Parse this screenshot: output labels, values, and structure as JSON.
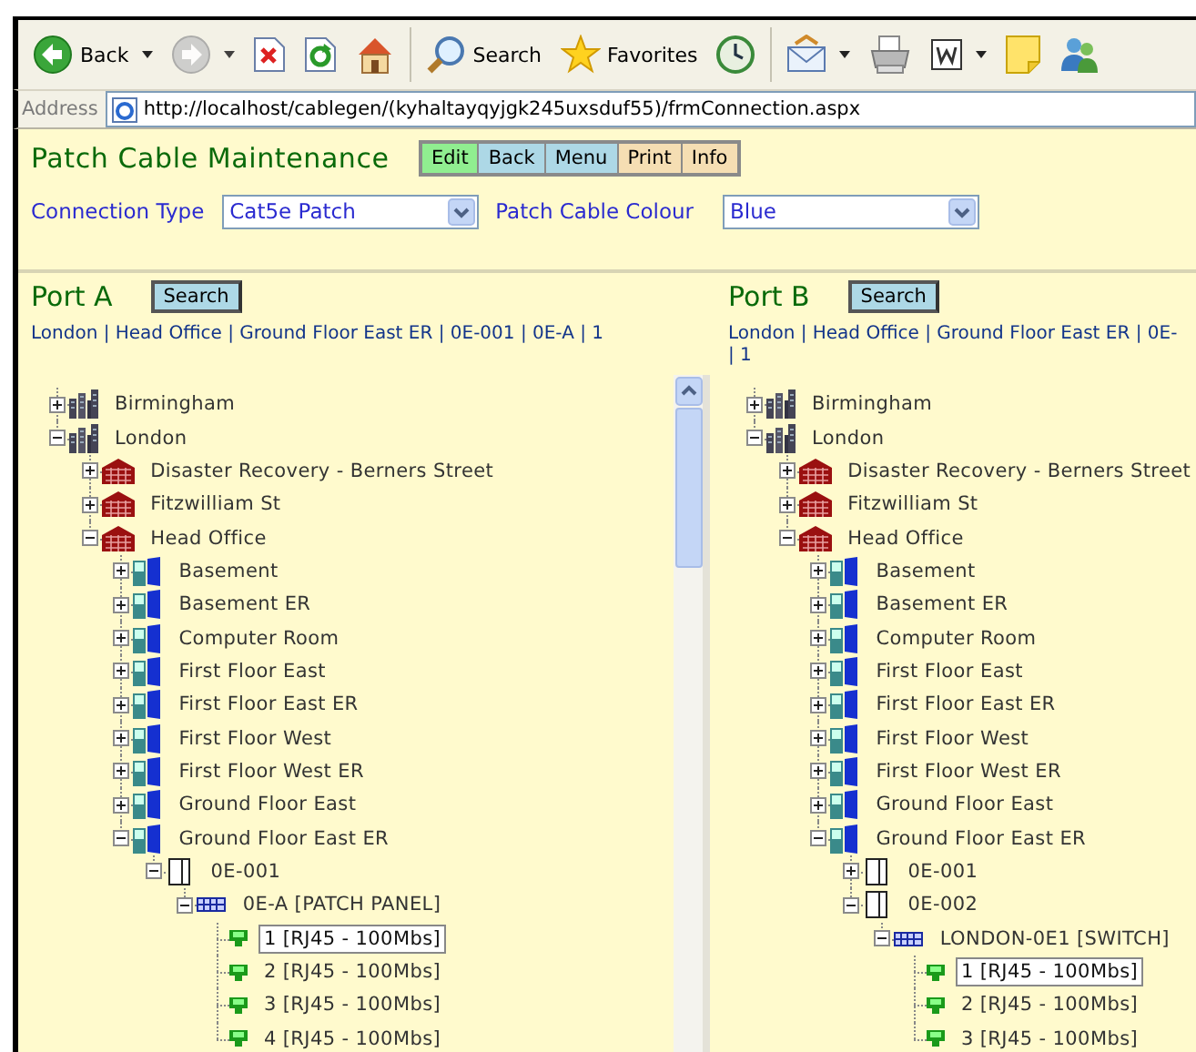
{
  "browser": {
    "toolbar": [
      {
        "kind": "back",
        "label": "Back",
        "dropdown": true,
        "disabled": false
      },
      {
        "kind": "forward",
        "dropdown": true,
        "disabled": true
      },
      {
        "kind": "stop",
        "dropdown": false,
        "disabled": false
      },
      {
        "kind": "refresh",
        "dropdown": false,
        "disabled": false
      },
      {
        "kind": "home",
        "dropdown": false,
        "disabled": false
      },
      {
        "kind": "separator"
      },
      {
        "kind": "search",
        "label": "Search",
        "dropdown": false,
        "disabled": false
      },
      {
        "kind": "favorites",
        "label": "Favorites",
        "dropdown": false,
        "disabled": false
      },
      {
        "kind": "history",
        "dropdown": false,
        "disabled": false
      },
      {
        "kind": "separator"
      },
      {
        "kind": "mail",
        "dropdown": true,
        "disabled": false
      },
      {
        "kind": "print",
        "dropdown": false,
        "disabled": false
      },
      {
        "kind": "word",
        "dropdown": true,
        "disabled": false
      },
      {
        "kind": "note",
        "dropdown": false,
        "disabled": false
      },
      {
        "kind": "messenger",
        "dropdown": false,
        "disabled": false
      }
    ],
    "address_label": "Address",
    "url": "http://localhost/cablegen/(kyhaltayqyjgk245uxsduf55)/frmConnection.aspx"
  },
  "page": {
    "title": "Patch Cable Maintenance",
    "buttons": [
      {
        "label": "Edit",
        "color": "#90ee90"
      },
      {
        "label": "Back",
        "color": "#add8e6"
      },
      {
        "label": "Menu",
        "color": "#add8e6"
      },
      {
        "label": "Print",
        "color": "#f5deb3"
      },
      {
        "label": "Info",
        "color": "#f5deb3"
      }
    ],
    "fields": [
      {
        "label": "Connection Type",
        "value": "Cat5e Patch"
      },
      {
        "label": "Patch Cable Colour",
        "value": "Blue"
      }
    ],
    "ports": [
      {
        "title": "Port A",
        "search_button": "Search",
        "path_lines": [
          "London | Head Office | Ground Floor East ER | 0E-001 | 0E-A | 1"
        ],
        "tree": [
          {
            "label": "Birmingham",
            "kind": "city",
            "expanded": false,
            "selected": false
          },
          {
            "label": "London",
            "kind": "city",
            "expanded": true,
            "selected": false,
            "children": [
              {
                "label": "Disaster Recovery - Berners Street",
                "kind": "site",
                "expanded": false,
                "selected": false
              },
              {
                "label": "Fitzwilliam St",
                "kind": "site",
                "expanded": false,
                "selected": false
              },
              {
                "label": "Head Office",
                "kind": "site",
                "expanded": true,
                "selected": false,
                "children": [
                  {
                    "label": "Basement",
                    "kind": "floor",
                    "expanded": false,
                    "selected": false
                  },
                  {
                    "label": "Basement ER",
                    "kind": "floor",
                    "expanded": false,
                    "selected": false
                  },
                  {
                    "label": "Computer Room",
                    "kind": "floor",
                    "expanded": false,
                    "selected": false
                  },
                  {
                    "label": "First Floor East",
                    "kind": "floor",
                    "expanded": false,
                    "selected": false
                  },
                  {
                    "label": "First Floor East ER",
                    "kind": "floor",
                    "expanded": false,
                    "selected": false
                  },
                  {
                    "label": "First Floor West",
                    "kind": "floor",
                    "expanded": false,
                    "selected": false
                  },
                  {
                    "label": "First Floor West ER",
                    "kind": "floor",
                    "expanded": false,
                    "selected": false
                  },
                  {
                    "label": "Ground Floor East",
                    "kind": "floor",
                    "expanded": false,
                    "selected": false
                  },
                  {
                    "label": "Ground Floor East ER",
                    "kind": "floor",
                    "expanded": true,
                    "selected": false,
                    "children": [
                      {
                        "label": "0E-001",
                        "kind": "cabinet",
                        "expanded": true,
                        "selected": false,
                        "children": [
                          {
                            "label": "0E-A [PATCH PANEL]",
                            "kind": "panel",
                            "expanded": true,
                            "selected": false,
                            "children": [
                              {
                                "label": "1 [RJ45 - 100Mbs]",
                                "kind": "port",
                                "selected": true
                              },
                              {
                                "label": "2 [RJ45 - 100Mbs]",
                                "kind": "port",
                                "selected": false
                              },
                              {
                                "label": "3 [RJ45 - 100Mbs]",
                                "kind": "port",
                                "selected": false
                              },
                              {
                                "label": "4 [RJ45 - 100Mbs]",
                                "kind": "port",
                                "selected": false
                              }
                            ]
                          }
                        ]
                      }
                    ]
                  }
                ]
              }
            ]
          }
        ]
      },
      {
        "title": "Port B",
        "search_button": "Search",
        "path_lines": [
          "London | Head Office | Ground Floor East ER | 0E-",
          "| 1"
        ],
        "tree": [
          {
            "label": "Birmingham",
            "kind": "city",
            "expanded": false,
            "selected": false
          },
          {
            "label": "London",
            "kind": "city",
            "expanded": true,
            "selected": false,
            "children": [
              {
                "label": "Disaster Recovery - Berners Street",
                "kind": "site",
                "expanded": false,
                "selected": false
              },
              {
                "label": "Fitzwilliam St",
                "kind": "site",
                "expanded": false,
                "selected": false
              },
              {
                "label": "Head Office",
                "kind": "site",
                "expanded": true,
                "selected": false,
                "children": [
                  {
                    "label": "Basement",
                    "kind": "floor",
                    "expanded": false,
                    "selected": false
                  },
                  {
                    "label": "Basement ER",
                    "kind": "floor",
                    "expanded": false,
                    "selected": false
                  },
                  {
                    "label": "Computer Room",
                    "kind": "floor",
                    "expanded": false,
                    "selected": false
                  },
                  {
                    "label": "First Floor East",
                    "kind": "floor",
                    "expanded": false,
                    "selected": false
                  },
                  {
                    "label": "First Floor East ER",
                    "kind": "floor",
                    "expanded": false,
                    "selected": false
                  },
                  {
                    "label": "First Floor West",
                    "kind": "floor",
                    "expanded": false,
                    "selected": false
                  },
                  {
                    "label": "First Floor West ER",
                    "kind": "floor",
                    "expanded": false,
                    "selected": false
                  },
                  {
                    "label": "Ground Floor East",
                    "kind": "floor",
                    "expanded": false,
                    "selected": false
                  },
                  {
                    "label": "Ground Floor East ER",
                    "kind": "floor",
                    "expanded": true,
                    "selected": false,
                    "children": [
                      {
                        "label": "0E-001",
                        "kind": "cabinet",
                        "expanded": false,
                        "selected": false
                      },
                      {
                        "label": "0E-002",
                        "kind": "cabinet",
                        "expanded": true,
                        "selected": false,
                        "children": [
                          {
                            "label": "LONDON-0E1 [SWITCH]",
                            "kind": "panel",
                            "expanded": true,
                            "selected": false,
                            "children": [
                              {
                                "label": "1 [RJ45 - 100Mbs]",
                                "kind": "port",
                                "selected": true
                              },
                              {
                                "label": "2 [RJ45 - 100Mbs]",
                                "kind": "port",
                                "selected": false
                              },
                              {
                                "label": "3 [RJ45 - 100Mbs]",
                                "kind": "port",
                                "selected": false
                              }
                            ]
                          }
                        ]
                      }
                    ]
                  }
                ]
              }
            ]
          }
        ]
      }
    ]
  }
}
